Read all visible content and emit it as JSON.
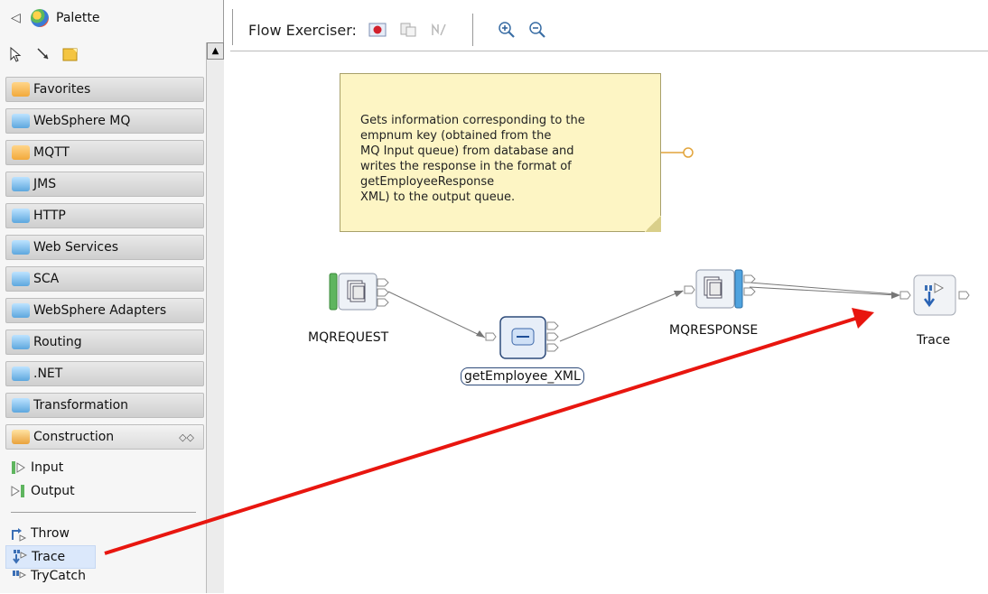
{
  "palette": {
    "title": "Palette",
    "drawers": [
      {
        "label": "Favorites",
        "icon": "favorites-folder-icon"
      },
      {
        "label": "WebSphere MQ",
        "icon": "mq-folder-icon"
      },
      {
        "label": "MQTT",
        "icon": "mqtt-folder-icon"
      },
      {
        "label": "JMS",
        "icon": "jms-folder-icon"
      },
      {
        "label": "HTTP",
        "icon": "http-folder-icon"
      },
      {
        "label": "Web Services",
        "icon": "web-services-folder-icon"
      },
      {
        "label": "SCA",
        "icon": "sca-folder-icon"
      },
      {
        "label": "WebSphere Adapters",
        "icon": "adapters-folder-icon"
      },
      {
        "label": "Routing",
        "icon": "routing-folder-icon"
      },
      {
        "label": ".NET",
        "icon": "dotnet-folder-icon"
      },
      {
        "label": "Transformation",
        "icon": "transformation-folder-icon"
      }
    ],
    "open_drawer": {
      "label": "Construction"
    },
    "items": [
      {
        "label": "Input"
      },
      {
        "label": "Output"
      },
      {
        "label": "Throw"
      },
      {
        "label": "Trace",
        "selected": true
      },
      {
        "label": "TryCatch"
      }
    ]
  },
  "toolbar": {
    "flow_exerciser_label": "Flow Exerciser:"
  },
  "note": {
    "text": "Gets information corresponding to the\nempnum key (obtained from the\nMQ Input queue) from database and\nwrites the response in the format of\ngetEmployeeResponse\nXML) to the output queue."
  },
  "nodes": {
    "mqrequest": "MQREQUEST",
    "compute": "getEmployee_XML",
    "mqresponse": "MQRESPONSE",
    "trace": "Trace"
  },
  "colors": {
    "annotation_arrow": "#e8160f",
    "note_background": "#fdf5c4",
    "selection": "#dbe8fb"
  }
}
